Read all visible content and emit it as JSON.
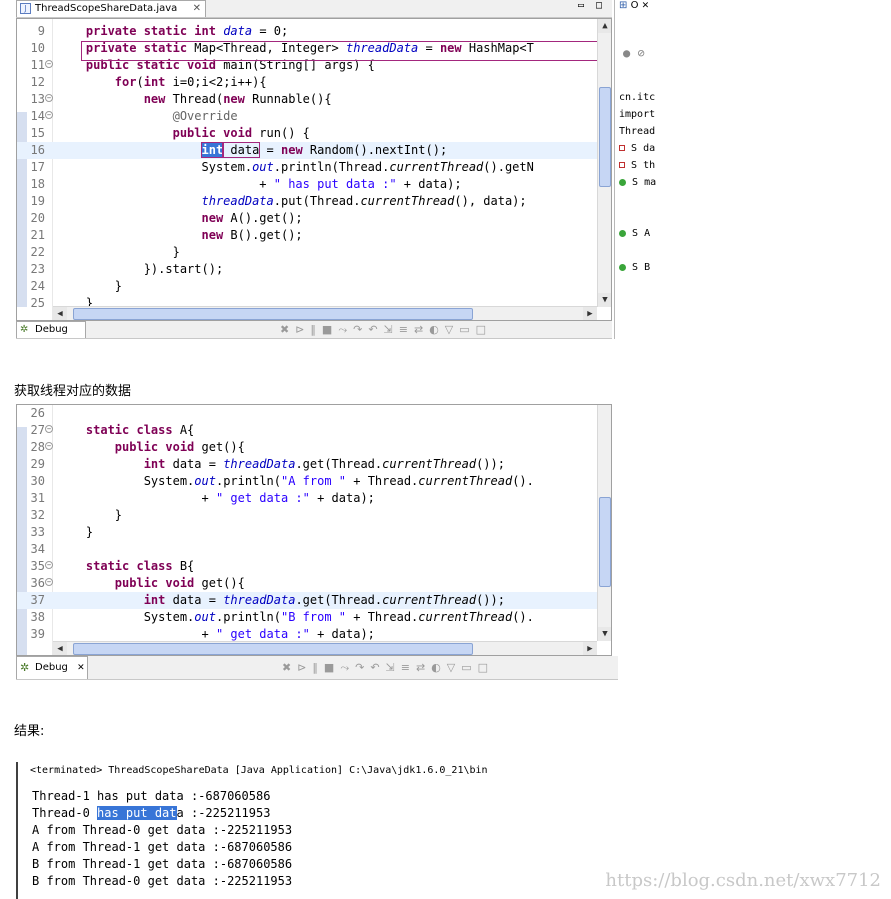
{
  "editor1": {
    "tab_title": "ThreadScopeShareData.java",
    "lines": [
      {
        "n": "9",
        "parts": [
          [
            "    ",
            ""
          ],
          [
            "private static int ",
            "kw"
          ],
          [
            "data",
            "fld"
          ],
          [
            " = 0;",
            ""
          ]
        ]
      },
      {
        "n": "10",
        "parts": [
          [
            "    ",
            ""
          ],
          [
            "private static ",
            "kw"
          ],
          [
            "Map<Thread, Integer> ",
            ""
          ],
          [
            "threadData",
            "fld"
          ],
          [
            " = ",
            ""
          ],
          [
            "new ",
            "kw"
          ],
          [
            "HashMap<T",
            ""
          ]
        ]
      },
      {
        "n": "11",
        "parts": [
          [
            "    ",
            ""
          ],
          [
            "public static void ",
            "kw"
          ],
          [
            "main(String[] args) {",
            ""
          ]
        ]
      },
      {
        "n": "12",
        "parts": [
          [
            "        ",
            ""
          ],
          [
            "for",
            "kw"
          ],
          [
            "(",
            ""
          ],
          [
            "int ",
            "kw"
          ],
          [
            "i=0;i<2;i++){",
            ""
          ]
        ]
      },
      {
        "n": "13",
        "parts": [
          [
            "            ",
            ""
          ],
          [
            "new ",
            "kw"
          ],
          [
            "Thread(",
            ""
          ],
          [
            "new ",
            "kw"
          ],
          [
            "Runnable(){",
            ""
          ]
        ]
      },
      {
        "n": "14",
        "parts": [
          [
            "                ",
            ""
          ],
          [
            "@Override",
            "ann"
          ]
        ]
      },
      {
        "n": "15",
        "parts": [
          [
            "                ",
            ""
          ],
          [
            "public void ",
            "kw"
          ],
          [
            "run() {",
            ""
          ]
        ]
      },
      {
        "n": "16",
        "parts": [
          [
            "                    ",
            ""
          ],
          [
            "int",
            "kw sel"
          ],
          [
            " data",
            ""
          ],
          [
            " = ",
            ""
          ],
          [
            "new ",
            "kw"
          ],
          [
            "Random().nextInt();",
            ""
          ]
        ]
      },
      {
        "n": "17",
        "parts": [
          [
            "                    System.",
            ""
          ],
          [
            "out",
            "stat"
          ],
          [
            ".println(Thread.",
            ""
          ],
          [
            "currentThread",
            "ital"
          ],
          [
            "().getN",
            ""
          ]
        ]
      },
      {
        "n": "18",
        "parts": [
          [
            "                            + ",
            ""
          ],
          [
            "\" has put data :\"",
            "str"
          ],
          [
            " + data);",
            ""
          ]
        ]
      },
      {
        "n": "19",
        "parts": [
          [
            "                    ",
            ""
          ],
          [
            "threadData",
            "fld"
          ],
          [
            ".put(Thread.",
            ""
          ],
          [
            "currentThread",
            "ital"
          ],
          [
            "(), data);",
            ""
          ]
        ]
      },
      {
        "n": "20",
        "parts": [
          [
            "                    ",
            ""
          ],
          [
            "new ",
            "kw"
          ],
          [
            "A().get();",
            ""
          ]
        ]
      },
      {
        "n": "21",
        "parts": [
          [
            "                    ",
            ""
          ],
          [
            "new ",
            "kw"
          ],
          [
            "B().get();",
            ""
          ]
        ]
      },
      {
        "n": "22",
        "parts": [
          [
            "                }",
            ""
          ]
        ]
      },
      {
        "n": "23",
        "parts": [
          [
            "            }).start();",
            ""
          ]
        ]
      },
      {
        "n": "24",
        "parts": [
          [
            "        }",
            ""
          ]
        ]
      },
      {
        "n": "25",
        "parts": [
          [
            "    }",
            ""
          ]
        ]
      }
    ],
    "bottom_tab": "Debug"
  },
  "outline": {
    "label": "O",
    "rows": [
      "cn.itc",
      "import",
      "Thread",
      "S da",
      "S th",
      "S ma",
      "",
      "S A",
      "",
      "S B",
      ""
    ]
  },
  "caption1": "获取线程对应的数据",
  "editor2": {
    "lines": [
      {
        "n": "26",
        "parts": [
          [
            "",
            ""
          ]
        ]
      },
      {
        "n": "27",
        "parts": [
          [
            "    ",
            ""
          ],
          [
            "static class ",
            "kw"
          ],
          [
            "A{",
            ""
          ]
        ]
      },
      {
        "n": "28",
        "parts": [
          [
            "        ",
            ""
          ],
          [
            "public void ",
            "kw"
          ],
          [
            "get(){",
            ""
          ]
        ]
      },
      {
        "n": "29",
        "parts": [
          [
            "            ",
            ""
          ],
          [
            "int ",
            "kw"
          ],
          [
            "data = ",
            ""
          ],
          [
            "threadData",
            "fld"
          ],
          [
            ".get(Thread.",
            ""
          ],
          [
            "currentThread",
            "ital"
          ],
          [
            "());",
            ""
          ]
        ]
      },
      {
        "n": "30",
        "parts": [
          [
            "            System.",
            ""
          ],
          [
            "out",
            "stat"
          ],
          [
            ".println(",
            ""
          ],
          [
            "\"A from \"",
            "str"
          ],
          [
            " + Thread.",
            ""
          ],
          [
            "currentThread",
            "ital"
          ],
          [
            "().",
            ""
          ]
        ]
      },
      {
        "n": "31",
        "parts": [
          [
            "                    + ",
            ""
          ],
          [
            "\" get data :\"",
            "str"
          ],
          [
            " + data);",
            ""
          ]
        ]
      },
      {
        "n": "32",
        "parts": [
          [
            "        }",
            ""
          ]
        ]
      },
      {
        "n": "33",
        "parts": [
          [
            "    }",
            ""
          ]
        ]
      },
      {
        "n": "34",
        "parts": [
          [
            "",
            ""
          ]
        ]
      },
      {
        "n": "35",
        "parts": [
          [
            "    ",
            ""
          ],
          [
            "static class ",
            "kw"
          ],
          [
            "B{",
            ""
          ]
        ]
      },
      {
        "n": "36",
        "parts": [
          [
            "        ",
            ""
          ],
          [
            "public void ",
            "kw"
          ],
          [
            "get(){",
            ""
          ]
        ]
      },
      {
        "n": "37",
        "parts": [
          [
            "            ",
            ""
          ],
          [
            "int ",
            "kw"
          ],
          [
            "data = ",
            ""
          ],
          [
            "threadData",
            "fld"
          ],
          [
            ".get(Thread.",
            ""
          ],
          [
            "currentThread",
            "ital"
          ],
          [
            "());",
            ""
          ]
        ]
      },
      {
        "n": "38",
        "parts": [
          [
            "            System.",
            ""
          ],
          [
            "out",
            "stat"
          ],
          [
            ".println(",
            ""
          ],
          [
            "\"B from \"",
            "str"
          ],
          [
            " + Thread.",
            ""
          ],
          [
            "currentThread",
            "ital"
          ],
          [
            "().",
            ""
          ]
        ]
      },
      {
        "n": "39",
        "parts": [
          [
            "                    + ",
            ""
          ],
          [
            "\" get data :\"",
            "str"
          ],
          [
            " + data);",
            ""
          ]
        ]
      }
    ],
    "bottom_tab": "Debug"
  },
  "caption2": "结果:",
  "console": {
    "header": "<terminated> ThreadScopeShareData [Java Application] C:\\Java\\jdk1.6.0_21\\bin",
    "lines": [
      "Thread-1 has put data :-687060586",
      "Thread-0 has put data :-225211953",
      "A from Thread-0 get data :-225211953",
      "A from Thread-1 get data :-687060586",
      "B from Thread-1 get data :-687060586",
      "B from Thread-0 get data :-225211953"
    ],
    "highlight": "has put dat"
  },
  "watermark": "https://blog.csdn.net/xwx7712"
}
